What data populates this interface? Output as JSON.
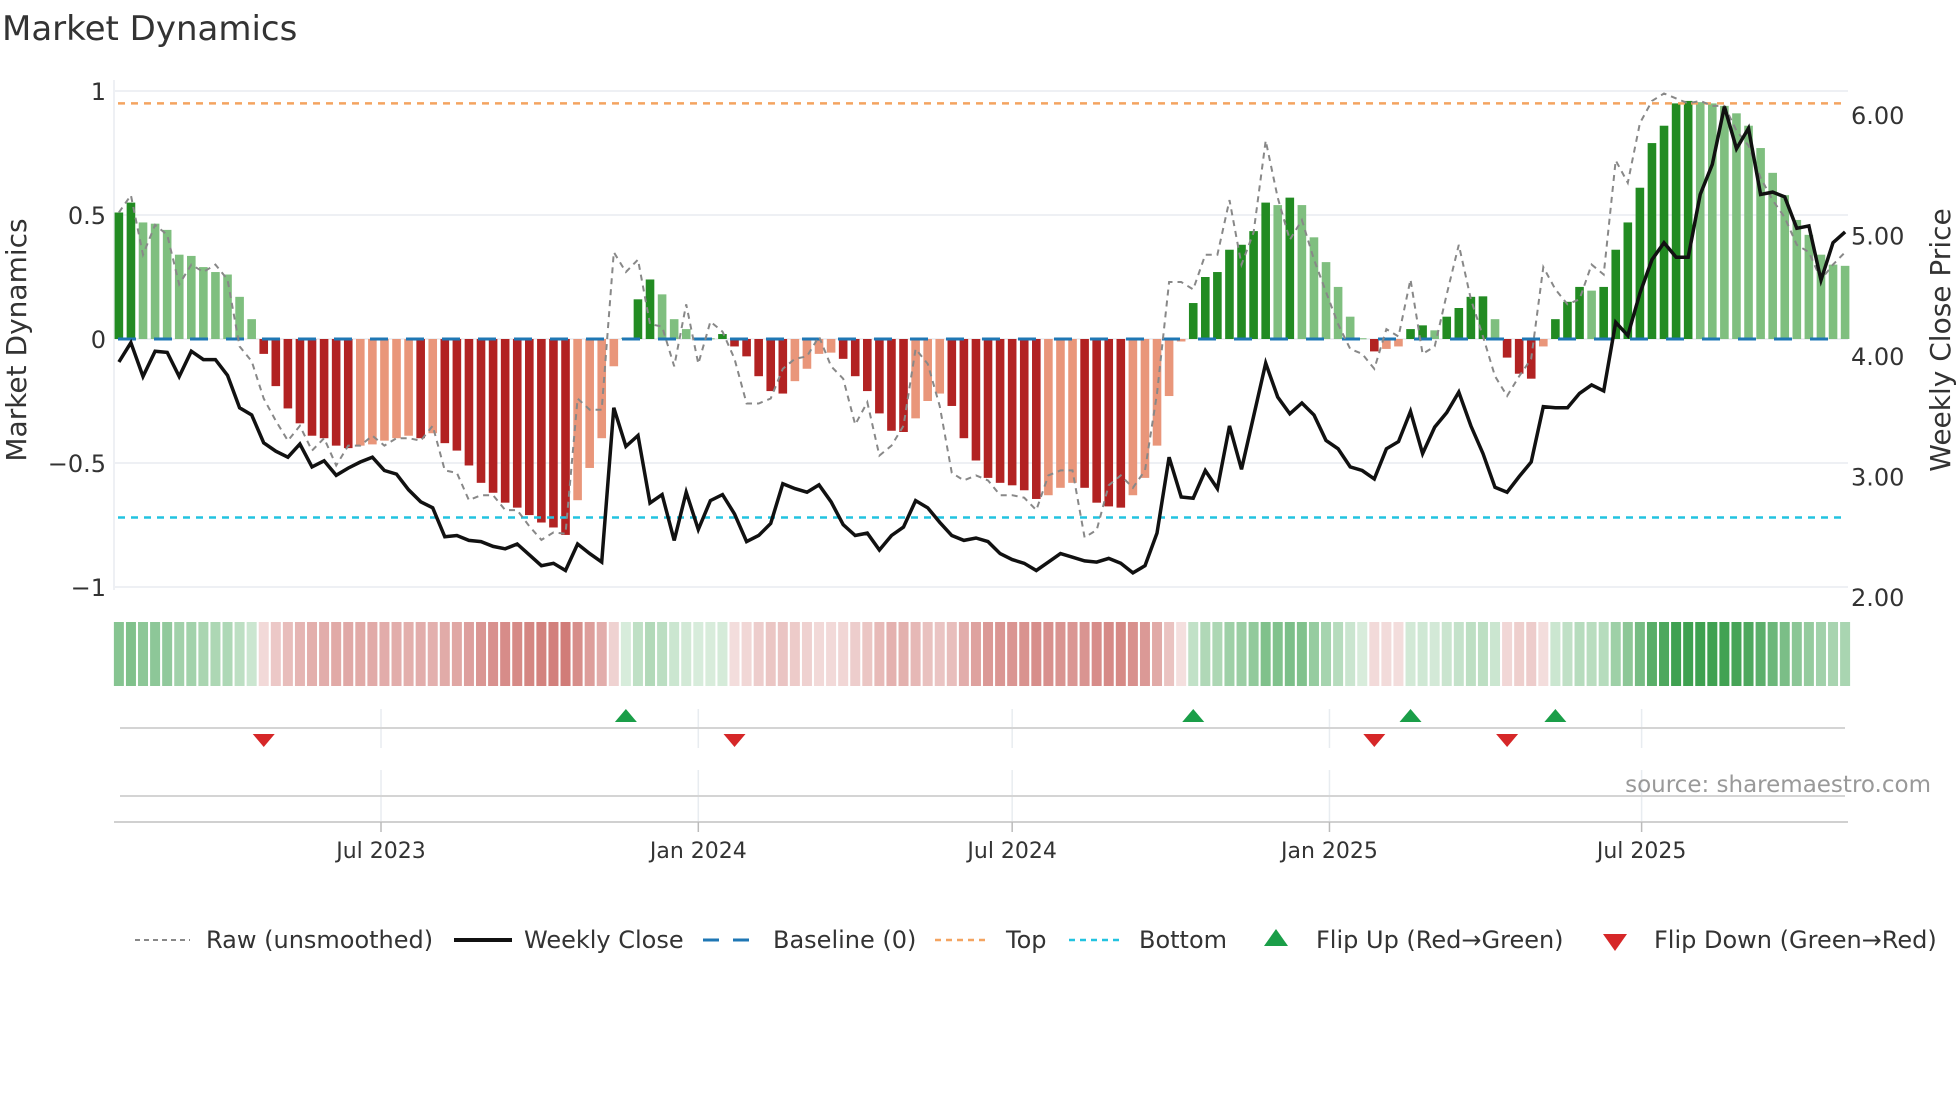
{
  "chart_data": {
    "type": "bar",
    "title": "Market Dynamics",
    "ylabel": "Market Dynamics",
    "y2label": "Weekly Close Price",
    "ylim": [
      -1,
      1
    ],
    "y2lim": [
      2.0,
      6.2
    ],
    "yticks": [
      "1",
      "0.5",
      "0",
      "−0.5",
      "−1"
    ],
    "ytick_values": [
      1,
      0.5,
      0,
      -0.5,
      -1
    ],
    "y2ticks": [
      "6.00",
      "5.00",
      "4.00",
      "3.00",
      "2.00"
    ],
    "y2tick_values": [
      6,
      5,
      4,
      3,
      2
    ],
    "x_start": "2023-01-30",
    "x_step_days": 7,
    "xticks": [
      {
        "label": "Jul 2023",
        "date": "2023-07-01"
      },
      {
        "label": "Jan 2024",
        "date": "2024-01-01"
      },
      {
        "label": "Jul 2024",
        "date": "2024-07-01"
      },
      {
        "label": "Jan 2025",
        "date": "2025-01-01"
      },
      {
        "label": "Jul 2025",
        "date": "2025-07-01"
      }
    ],
    "grid": true,
    "top_level": 0.95,
    "bottom_level": -0.72,
    "baseline": 0,
    "series": [
      {
        "name": "Market Dynamics (smoothed)",
        "kind": "bar",
        "values": [
          0.51,
          0.55,
          0.47,
          0.465,
          0.44,
          0.34,
          0.335,
          0.29,
          0.27,
          0.26,
          0.17,
          0.08,
          -0.06,
          -0.19,
          -0.28,
          -0.34,
          -0.39,
          -0.4,
          -0.43,
          -0.44,
          -0.43,
          -0.425,
          -0.41,
          -0.4,
          -0.39,
          -0.4,
          -0.38,
          -0.42,
          -0.45,
          -0.51,
          -0.58,
          -0.62,
          -0.66,
          -0.68,
          -0.71,
          -0.74,
          -0.76,
          -0.79,
          -0.65,
          -0.52,
          -0.4,
          -0.11,
          0.005,
          0.16,
          0.24,
          0.18,
          0.08,
          0.04,
          0.005,
          0.003,
          0.02,
          -0.03,
          -0.07,
          -0.15,
          -0.21,
          -0.22,
          -0.17,
          -0.12,
          -0.06,
          -0.055,
          -0.08,
          -0.15,
          -0.21,
          -0.3,
          -0.37,
          -0.375,
          -0.32,
          -0.25,
          -0.22,
          -0.27,
          -0.4,
          -0.49,
          -0.56,
          -0.58,
          -0.59,
          -0.61,
          -0.645,
          -0.63,
          -0.6,
          -0.58,
          -0.6,
          -0.66,
          -0.675,
          -0.68,
          -0.63,
          -0.56,
          -0.43,
          -0.23,
          -0.01,
          0.145,
          0.25,
          0.27,
          0.36,
          0.38,
          0.435,
          0.55,
          0.54,
          0.57,
          0.54,
          0.41,
          0.31,
          0.21,
          0.09,
          0.003,
          -0.05,
          -0.04,
          -0.03,
          0.04,
          0.055,
          0.035,
          0.09,
          0.125,
          0.17,
          0.172,
          0.08,
          -0.075,
          -0.14,
          -0.16,
          -0.03,
          0.08,
          0.15,
          0.21,
          0.195,
          0.21,
          0.36,
          0.47,
          0.61,
          0.79,
          0.86,
          0.95,
          0.96,
          0.955,
          0.95,
          0.94,
          0.91,
          0.86,
          0.77,
          0.67,
          0.58,
          0.48,
          0.42,
          0.34,
          0.3,
          0.295
        ]
      },
      {
        "name": "Raw (unsmoothed)",
        "kind": "line",
        "values": [
          0.51,
          0.58,
          0.34,
          0.46,
          0.42,
          0.22,
          0.3,
          0.27,
          0.3,
          0.24,
          -0.03,
          -0.09,
          -0.24,
          -0.33,
          -0.41,
          -0.35,
          -0.45,
          -0.4,
          -0.51,
          -0.43,
          -0.43,
          -0.39,
          -0.43,
          -0.4,
          -0.4,
          -0.41,
          -0.35,
          -0.53,
          -0.54,
          -0.65,
          -0.63,
          -0.63,
          -0.69,
          -0.69,
          -0.755,
          -0.81,
          -0.78,
          -0.785,
          -0.24,
          -0.285,
          -0.285,
          0.35,
          0.27,
          0.32,
          0.06,
          0.05,
          -0.11,
          0.14,
          -0.1,
          0.07,
          0.03,
          -0.08,
          -0.26,
          -0.26,
          -0.24,
          -0.12,
          -0.08,
          -0.07,
          0.01,
          -0.11,
          -0.16,
          -0.345,
          -0.255,
          -0.47,
          -0.43,
          -0.35,
          -0.04,
          -0.1,
          -0.27,
          -0.54,
          -0.57,
          -0.55,
          -0.57,
          -0.63,
          -0.63,
          -0.64,
          -0.69,
          -0.55,
          -0.53,
          -0.53,
          -0.8,
          -0.77,
          -0.59,
          -0.55,
          -0.6,
          -0.53,
          -0.22,
          0.23,
          0.23,
          0.2,
          0.34,
          0.34,
          0.56,
          0.3,
          0.43,
          0.8,
          0.57,
          0.4,
          0.48,
          0.32,
          0.19,
          0.06,
          -0.04,
          -0.06,
          -0.12,
          0.04,
          0.01,
          0.24,
          -0.06,
          -0.03,
          0.18,
          0.38,
          0.16,
          0.01,
          -0.15,
          -0.23,
          -0.15,
          -0.08,
          0.29,
          0.2,
          0.14,
          0.16,
          0.3,
          0.26,
          0.72,
          0.63,
          0.87,
          0.96,
          0.99,
          0.97,
          0.95,
          0.96,
          0.94,
          0.94,
          0.84,
          0.78,
          0.65,
          0.56,
          0.49,
          0.38,
          0.35,
          0.24,
          0.3,
          0.35
        ]
      },
      {
        "name": "Weekly Close",
        "kind": "line",
        "axis": "right",
        "values": [
          3.95,
          4.11,
          3.83,
          4.04,
          4.03,
          3.83,
          4.04,
          3.97,
          3.97,
          3.84,
          3.57,
          3.51,
          3.28,
          3.21,
          3.16,
          3.27,
          3.08,
          3.13,
          3.01,
          3.07,
          3.12,
          3.16,
          3.05,
          3.02,
          2.89,
          2.79,
          2.74,
          2.5,
          2.51,
          2.47,
          2.46,
          2.42,
          2.4,
          2.44,
          2.35,
          2.26,
          2.28,
          2.22,
          2.44,
          2.36,
          2.29,
          3.57,
          3.25,
          3.34,
          2.78,
          2.85,
          2.47,
          2.87,
          2.56,
          2.8,
          2.85,
          2.69,
          2.46,
          2.51,
          2.61,
          2.94,
          2.9,
          2.87,
          2.93,
          2.79,
          2.6,
          2.51,
          2.53,
          2.39,
          2.51,
          2.58,
          2.8,
          2.74,
          2.62,
          2.51,
          2.47,
          2.49,
          2.46,
          2.36,
          2.31,
          2.28,
          2.22,
          2.29,
          2.36,
          2.33,
          2.3,
          2.29,
          2.32,
          2.28,
          2.2,
          2.26,
          2.53,
          3.16,
          2.83,
          2.82,
          3.05,
          2.9,
          3.42,
          3.06,
          3.5,
          3.94,
          3.66,
          3.52,
          3.61,
          3.51,
          3.3,
          3.23,
          3.08,
          3.05,
          2.98,
          3.23,
          3.29,
          3.54,
          3.19,
          3.41,
          3.53,
          3.7,
          3.42,
          3.19,
          2.91,
          2.87,
          3.0,
          3.12,
          3.58,
          3.57,
          3.57,
          3.69,
          3.76,
          3.71,
          4.28,
          4.17,
          4.52,
          4.8,
          4.94,
          4.82,
          4.82,
          5.34,
          5.59,
          6.07,
          5.72,
          5.89,
          5.34,
          5.36,
          5.32,
          5.06,
          5.08,
          4.63,
          4.94,
          5.03
        ]
      }
    ],
    "flip_up_weeks": [
      43,
      90,
      108,
      120
    ],
    "flip_down_weeks": [
      13,
      52,
      105,
      116
    ],
    "legend": {
      "placement": "bottom",
      "raw": "Raw (unsmoothed)",
      "close": "Weekly Close",
      "baseline": "Baseline (0)",
      "top": "Top",
      "bottom": "Bottom",
      "flip_up": "Flip Up (Red→Green)",
      "flip_down": "Flip Down (Green→Red)"
    },
    "source": "source: sharemaestro.com",
    "colors": {
      "bar_up_strong": "#228b22",
      "bar_up_weak": "#7fbf7f",
      "bar_down_strong": "#b22222",
      "bar_down_weak": "#e9967a",
      "raw": "#888888",
      "close": "#111111",
      "baseline": "#1f77b4",
      "top": "#f4a460",
      "bottom": "#22c3e0",
      "flip_up": "#1a9e48",
      "flip_down": "#d62728"
    }
  }
}
